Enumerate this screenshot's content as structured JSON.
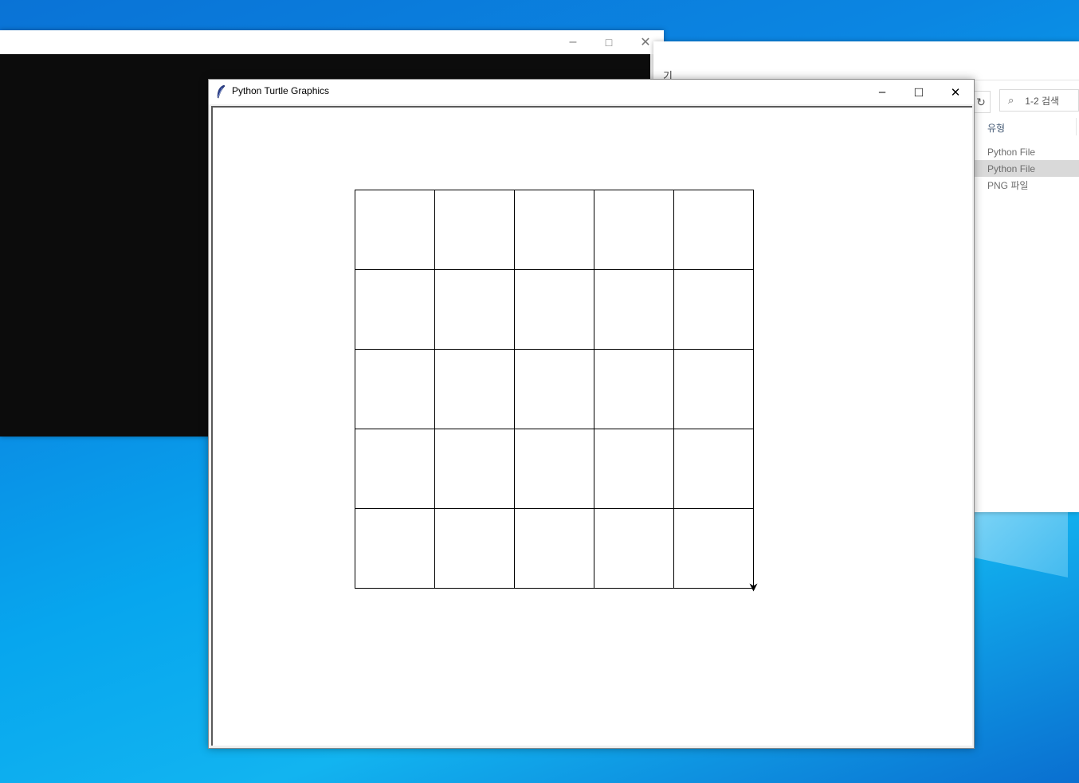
{
  "turtle_window": {
    "title": "Python Turtle Graphics",
    "grid": {
      "rows": 5,
      "cols": 5
    },
    "controls": {
      "minimize": "–",
      "maximize": "□",
      "close": "✕"
    }
  },
  "console_window": {
    "controls": {
      "minimize": "–",
      "maximize": "□",
      "close": "✕"
    }
  },
  "explorer_window": {
    "ribbon_fragment": "기",
    "search_placeholder": "1-2 검색",
    "column_header": "유형",
    "rows": [
      {
        "type": "Python File",
        "selected": false
      },
      {
        "type": "Python File",
        "selected": true
      },
      {
        "type": "PNG 파일",
        "selected": false
      }
    ]
  },
  "colors": {
    "desktop": "#0b86e2",
    "console_bg": "#0c0c0c",
    "selection": "#d9d9d9"
  }
}
